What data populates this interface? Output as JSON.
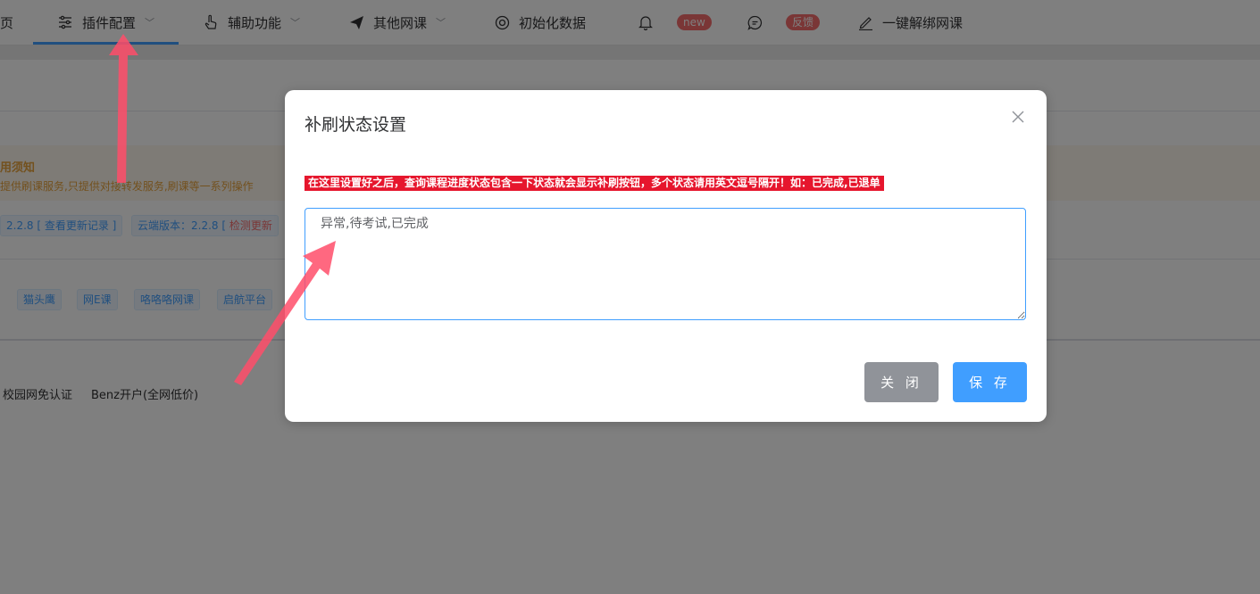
{
  "nav": {
    "items": [
      {
        "label": "页",
        "icon": ""
      },
      {
        "label": "插件配置",
        "icon": "sliders-icon"
      },
      {
        "label": "辅助功能",
        "icon": "hand-pointer-icon"
      },
      {
        "label": "其他网课",
        "icon": "send-icon"
      },
      {
        "label": "初始化数据",
        "icon": "lifebuoy-icon"
      },
      {
        "label": "",
        "icon": "bell-icon"
      },
      {
        "label": "",
        "icon": "chat-icon"
      },
      {
        "label": "一键解绑网课",
        "icon": "edit-icon"
      }
    ],
    "badge_new": "new",
    "badge_feedback": "反馈"
  },
  "notice": {
    "title": "用须知",
    "text": "提供刷课服务,只提供对接转发服务,刷课等一系列操作"
  },
  "version": {
    "local": "2.2.8 [ 查看更新记录 ]",
    "cloud_label": "云端版本：2.2.8 [ ",
    "check": "检测更新"
  },
  "platform_tags": [
    "",
    "猫头鹰",
    "网E课",
    "咯咯咯网课",
    "启航平台"
  ],
  "links": [
    "校园网免认证",
    "Benz开户(全网低价)"
  ],
  "dialog": {
    "title": "补刷状态设置",
    "hint": "在这里设置好之后，查询课程进度状态包含一下状态就会显示补刷按钮，多个状态请用英文逗号隔开！如：已完成,已退单",
    "textarea_value": "异常,待考试,已完成",
    "close_label": "关 闭",
    "save_label": "保 存"
  },
  "colors": {
    "accent": "#409eff",
    "hint_bg": "#e6162d",
    "arrow": "#ff4d6a",
    "close_btn": "#909399"
  }
}
